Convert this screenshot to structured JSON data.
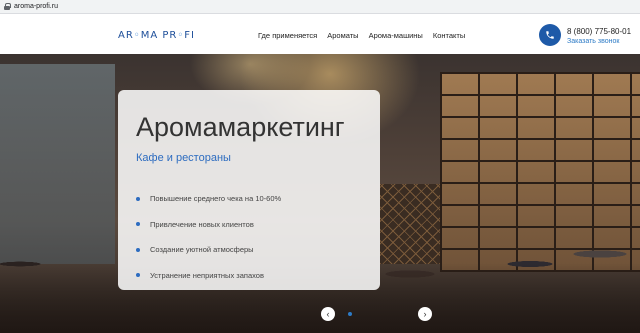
{
  "browser": {
    "url": "aroma-profi.ru"
  },
  "header": {
    "logo": {
      "part1": "AR",
      "part2": "MA PR",
      "part3": "FI"
    },
    "nav": [
      "Где применяется",
      "Ароматы",
      "Арома-машины",
      "Контакты"
    ],
    "phone": "8 (800) 775-80-01",
    "callback": "Заказать звонок",
    "phone_icon": "phone-icon",
    "accent": "#1e5aa8"
  },
  "hero": {
    "title": "Аромамаркетинг",
    "subtitle": "Кафе и рестораны",
    "bullets": [
      "Повышение среднего чека на 10-60%",
      "Привлечение новых клиентов",
      "Создание уютной атмосферы",
      "Устранение неприятных запахов"
    ],
    "slider": {
      "prev_icon": "‹",
      "next_icon": "›"
    }
  }
}
